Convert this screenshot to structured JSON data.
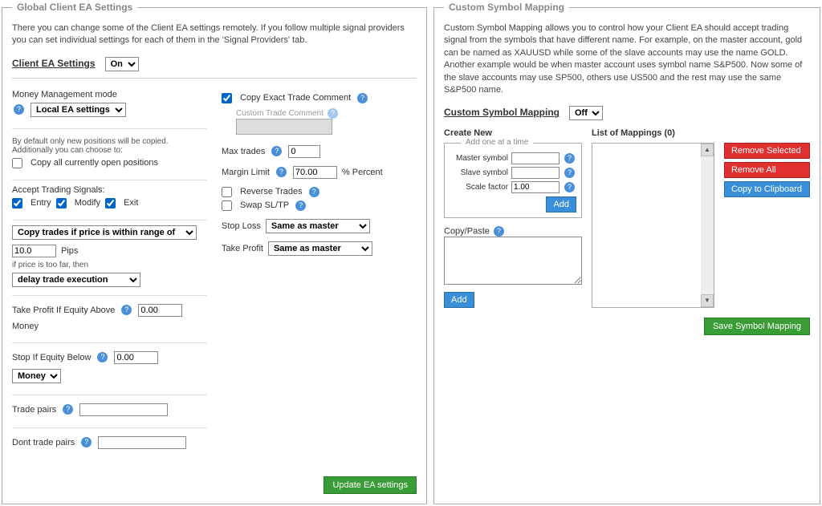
{
  "left": {
    "legend": "Global Client EA Settings",
    "desc": "There you can change some of the Client EA settings remotely. If you follow multiple signal providers you can set individual settings for each of them in the 'Signal Providers' tab.",
    "header": "Client EA Settings",
    "toggle": "On",
    "mm": {
      "label": "Money Management mode",
      "value": "Local EA settings"
    },
    "copyNote": "By default only new positions will be copied. Additionally you can choose to:",
    "copyAllLabel": "Copy all currently open positions",
    "acceptLabel": "Accept Trading Signals:",
    "entry": "Entry",
    "modify": "Modify",
    "exit": "Exit",
    "rangeSelect": "Copy trades if price is within range of",
    "rangeVal": "10.0",
    "pips": "Pips",
    "tooFar": "if price is too far, then",
    "delayOpt": "delay trade execution",
    "tpEquityLabel": "Take Profit If Equity Above",
    "tpEquityVal": "0.00",
    "moneyText": "Money",
    "stopEquityLabel": "Stop If Equity Below",
    "stopEquityVal": "0.00",
    "moneySelect": "Money",
    "tradePairs": "Trade pairs",
    "dontTradePairs": "Dont trade pairs",
    "copyExact": "Copy Exact Trade Comment",
    "customComment": "Custom Trade Comment",
    "maxTradesLabel": "Max trades",
    "maxTradesVal": "0",
    "marginLabel": "Margin Limit",
    "marginVal": "70.00",
    "percent": "% Percent",
    "reverse": "Reverse Trades",
    "swap": "Swap SL/TP",
    "slLabel": "Stop Loss",
    "slVal": "Same as master",
    "tpLabel": "Take Profit",
    "tpVal": "Same as master",
    "updateBtn": "Update EA settings"
  },
  "right": {
    "legend": "Custom Symbol Mapping",
    "desc": "Custom Symbol Mapping allows you to control how your Client EA should accept trading signal from the symbols that have different name. For example, on the master account, gold can be named as XAUUSD while some of the slave accounts may use the name GOLD. Another example would be when master account uses symbol name S&P500. Now some of the slave accounts may use SP500, others use US500 and the rest may use the same S&P500 name.",
    "header": "Custom Symbol Mapping",
    "toggle": "Off",
    "createNew": "Create New",
    "addOne": "Add one at a time",
    "masterSymbol": "Master symbol",
    "slaveSymbol": "Slave symbol",
    "scaleFactor": "Scale factor",
    "scaleVal": "1.00",
    "addBtn": "Add",
    "copyPaste": "Copy/Paste",
    "listTitle": "List of Mappings (0)",
    "removeSelected": "Remove Selected",
    "removeAll": "Remove All",
    "copyClipboard": "Copy to Clipboard",
    "saveBtn": "Save Symbol Mapping"
  }
}
